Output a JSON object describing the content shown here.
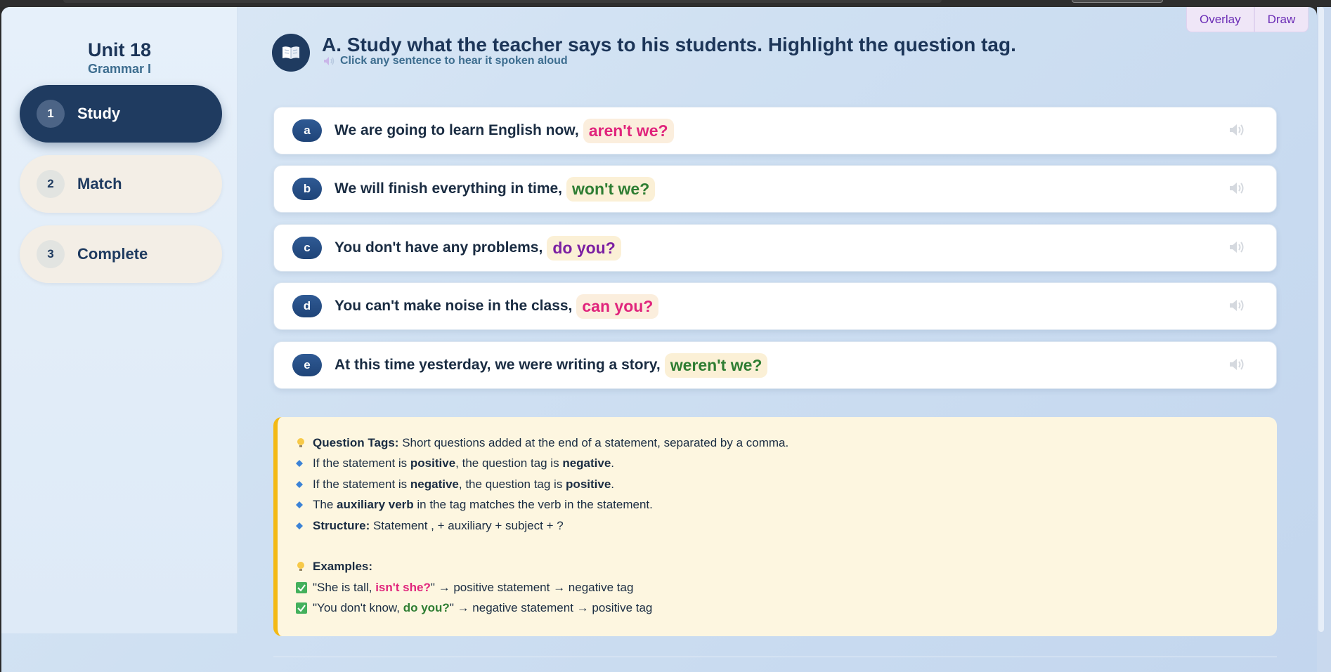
{
  "sidebar": {
    "unit_title": "Unit 18",
    "unit_subtitle": "Grammar I",
    "items": [
      {
        "num": "1",
        "label": "Study",
        "active": true
      },
      {
        "num": "2",
        "label": "Match",
        "active": false
      },
      {
        "num": "3",
        "label": "Complete",
        "active": false
      }
    ]
  },
  "toolbar": {
    "overlay_label": "Overlay",
    "draw_label": "Draw"
  },
  "header": {
    "title": "A. Study what the teacher says to his students. Highlight the question tag.",
    "subtitle": "Click any sentence to hear it spoken aloud",
    "icon": "book-icon"
  },
  "sentences": [
    {
      "letter": "a",
      "text": "We are going to learn English now,",
      "tag": "aren't we?",
      "tag_color": "#e0247c"
    },
    {
      "letter": "b",
      "text": "We will finish everything in time,",
      "tag": "won't we?",
      "tag_color": "#2e7d32"
    },
    {
      "letter": "c",
      "text": "You don't have any problems,",
      "tag": "do you?",
      "tag_color": "#7b1fa2"
    },
    {
      "letter": "d",
      "text": "You can't make noise in the class,",
      "tag": "can you?",
      "tag_color": "#e0247c"
    },
    {
      "letter": "e",
      "text": "At this time yesterday, we were writing a story,",
      "tag": "weren't we?",
      "tag_color": "#2e7d32"
    }
  ],
  "info": {
    "qt_label": "Question Tags:",
    "qt_text": " Short questions added at the end of a statement, separated by a comma.",
    "rule1": {
      "a": "If the statement is ",
      "b": "positive",
      "c": ", the question tag is ",
      "d": "negative",
      "e": "."
    },
    "rule2": {
      "a": "If the statement is ",
      "b": "negative",
      "c": ", the question tag is ",
      "d": "positive",
      "e": "."
    },
    "rule3": {
      "a": "The ",
      "b": "auxiliary verb",
      "c": " in the tag matches the verb in the statement."
    },
    "rule4": {
      "a": "Structure:",
      "b": " Statement , + auxiliary + subject + ?"
    },
    "examples_label": "Examples:",
    "ex1": {
      "a": "\"She is tall, ",
      "b": "isn't she?",
      "c": "\" → positive statement → negative tag"
    },
    "ex2": {
      "a": "\"You don't know, ",
      "b": "do you?",
      "c": "\" → negative statement → positive tag"
    }
  },
  "colors": {
    "accent_dark": "#1f3b60",
    "tag_pink": "#e0247c",
    "tag_green": "#2e7d32",
    "tag_purple": "#7b1fa2",
    "note_border": "#f3b915"
  }
}
